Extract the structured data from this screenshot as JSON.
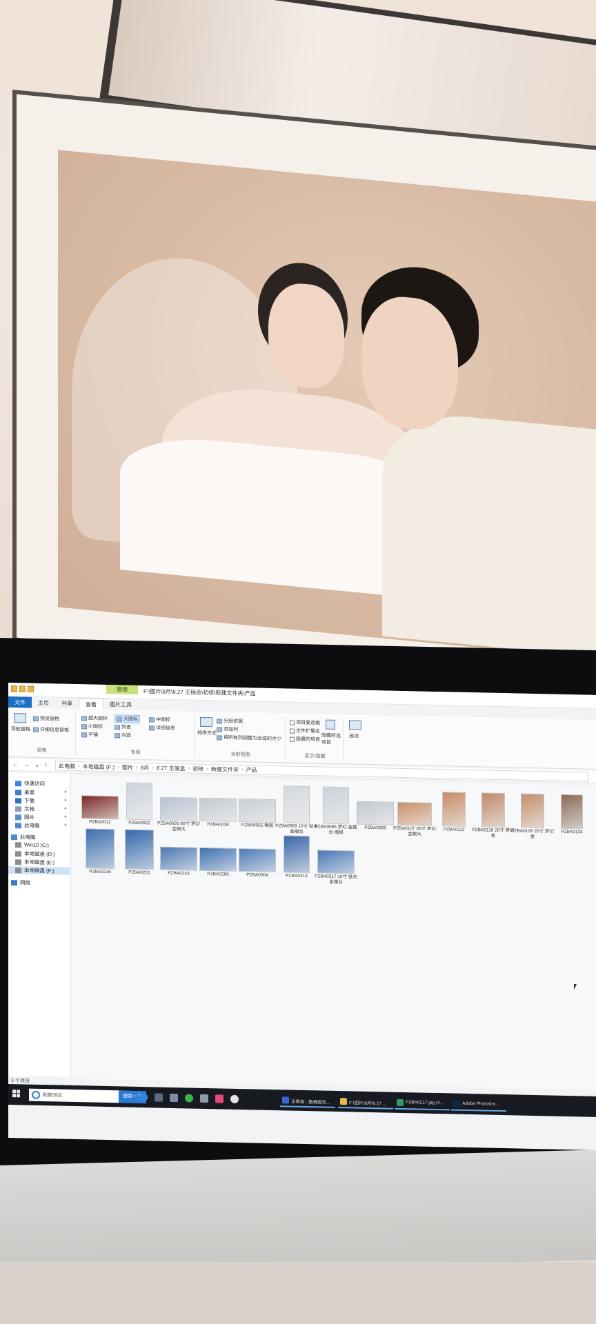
{
  "window": {
    "title_path": "F:\\图片\\8月\\8.27 王俪丞\\初修\\新建文件夹\\产品",
    "context_tab": "管理"
  },
  "ribbon": {
    "tabs": [
      "文件",
      "主页",
      "共享",
      "查看",
      "图片工具"
    ],
    "active_tab": "查看",
    "nav_pane": {
      "big_label": "导航窗格",
      "preview": "预览窗格",
      "details": "详细信息窗格",
      "label": "窗格"
    },
    "layout": {
      "items": [
        "超大图标",
        "大图标",
        "中图标",
        "小图标",
        "列表",
        "详细信息",
        "平铺",
        "内容"
      ],
      "selected": "大图标",
      "label": "布局"
    },
    "current_view": {
      "sort": "排序方式",
      "group": "分组依据",
      "add_column": "添加列",
      "fit_columns": "将所有列调整为合适的大小",
      "label": "当前视图"
    },
    "show_hide": {
      "checkbox": "项目复选框",
      "extensions": "文件扩展名",
      "hidden": "隐藏的项目",
      "hide_selected": "隐藏所选项目",
      "label": "显示/隐藏"
    },
    "options": "选项"
  },
  "address": {
    "crumbs": [
      "此电脑",
      "本地磁盘 (F:)",
      "图片",
      "8月",
      "8.27 王俪丞",
      "初修",
      "新建文件夹",
      "产品"
    ]
  },
  "sidebar": {
    "items": [
      {
        "label": "快速访问",
        "icon": "star-icon"
      },
      {
        "label": "桌面",
        "icon": "desktop-icon",
        "pinned": true
      },
      {
        "label": "下载",
        "icon": "download-icon",
        "pinned": true
      },
      {
        "label": "文档",
        "icon": "document-icon",
        "pinned": true
      },
      {
        "label": "图片",
        "icon": "picture-icon",
        "pinned": true
      },
      {
        "label": "此电脑",
        "icon": "computer-icon",
        "pinned": true
      },
      {
        "label": "此电脑",
        "icon": "computer-icon"
      },
      {
        "label": "Win10 (C:)",
        "icon": "drive-icon"
      },
      {
        "label": "本地磁盘 (D:)",
        "icon": "drive-icon"
      },
      {
        "label": "本地磁盘 (E:)",
        "icon": "drive-icon"
      },
      {
        "label": "本地磁盘 (F:)",
        "icon": "drive-icon",
        "selected": true
      },
      {
        "label": "网络",
        "icon": "network-icon"
      }
    ]
  },
  "files": [
    {
      "name": "PZBA0012",
      "tone": "#7a2a24"
    },
    {
      "name": "PZBA0022",
      "tone": "#cdd3dc"
    },
    {
      "name": "PZBA0026  80寸 梦幻金銀大",
      "tone": "#b8c2cf"
    },
    {
      "name": "PZBA0038",
      "tone": "#c3c9d2"
    },
    {
      "name": "PZBA0055  梅报",
      "tone": "#c9ced6"
    },
    {
      "name": "PZBA0068 10寸 钛合金摆台",
      "tone": "#d4d8de"
    },
    {
      "name": "PZBA0085 梦幻 金摆台  梅报",
      "tone": "#ccd2da"
    },
    {
      "name": "PZBA0088",
      "tone": "#c2c8d0"
    },
    {
      "name": "PZBA0107 30寸 梦幻金銀大",
      "tone": "#c98f6a"
    },
    {
      "name": "PZBA0113",
      "tone": "#c88c66"
    },
    {
      "name": "PZBA0118 20寸 梦幻金",
      "tone": "#c08a6c"
    },
    {
      "name": "PZBA0128 20寸 梦幻金",
      "tone": "#c4906e"
    },
    {
      "name": "PZBA0134",
      "tone": "#8a6a55"
    },
    {
      "name": "PZBA0216",
      "tone": "#3d6fb0"
    },
    {
      "name": "PZBA0221",
      "tone": "#3568ad"
    },
    {
      "name": "PZBA0253",
      "tone": "#4b79b4"
    },
    {
      "name": "PZBA0266",
      "tone": "#3f71b3"
    },
    {
      "name": "PZBA0304",
      "tone": "#4d7cb8"
    },
    {
      "name": "PZBA0313",
      "tone": "#3c69a8"
    },
    {
      "name": "PZBA0317  10寸 钛合金摆台",
      "tone": "#4a78b6"
    }
  ],
  "status": {
    "count": "3 个项目"
  },
  "taskbar": {
    "search_placeholder": "刷屏测试",
    "search_button": "搜索一下",
    "tasks": [
      {
        "label": "王季席 - 勤佛图乐...",
        "tone": "#3a66d8"
      },
      {
        "label": "F:\\图片\\8月\\8.27 ...",
        "tone": "#e8b94a"
      },
      {
        "label": "PZBA0217.jpg (4...",
        "tone": "#2f9c6a"
      },
      {
        "label": "Adobe Photosho...",
        "tone": "#0d2a4a"
      }
    ]
  }
}
